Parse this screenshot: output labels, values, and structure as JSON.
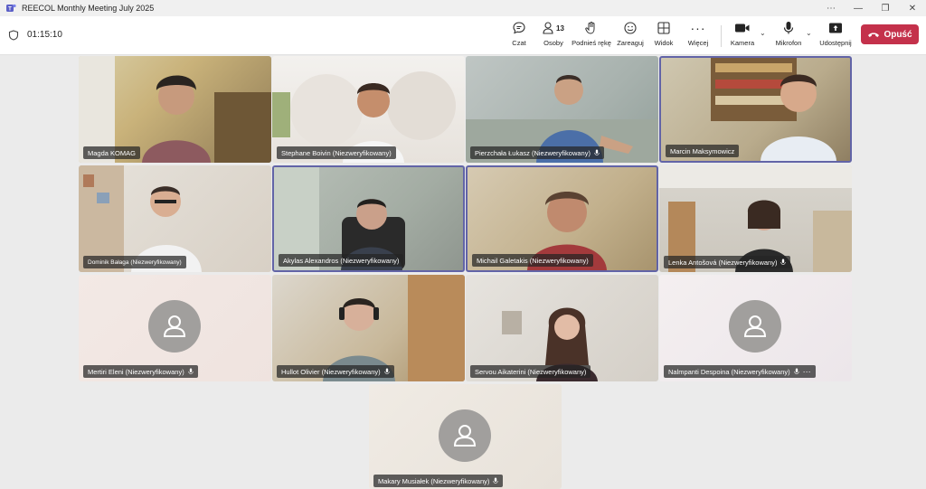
{
  "window": {
    "title": "REECOL Monthly Meeting July 2025",
    "controls": [
      "⋯",
      "—",
      "❐",
      "✕"
    ]
  },
  "toolbar": {
    "timer": "01:15:10",
    "chat": "Czat",
    "people": "Osoby",
    "people_count": "13",
    "raise": "Podnieś rękę",
    "react": "Zareaguj",
    "view": "Widok",
    "more": "Więcej",
    "camera": "Kamera",
    "mic": "Mikrofon",
    "share": "Udostępnij",
    "leave": "Opuść"
  },
  "colors": {
    "accent": "#6264a7",
    "leave": "#c4314b"
  },
  "participants": [
    {
      "name": "Magda KOMAG"
    },
    {
      "name": "Stephane Boivin (Niezweryfikowany)"
    },
    {
      "name": "Pierzchała Łukasz (Niezweryfikowany)"
    },
    {
      "name": "Marcin Maksymowicz"
    },
    {
      "name": "Dominik Bałaga (Niezweryfikowany)"
    },
    {
      "name": "Akylas Alexandros (Niezweryfikowany)"
    },
    {
      "name": "Michail Galetakis (Niezweryfikowany)"
    },
    {
      "name": "Lenka Antošová (Niezweryfikowany)"
    },
    {
      "name": "Mertiri Eleni (Niezweryfikowany)"
    },
    {
      "name": "Hullot Olivier (Niezweryfikowany)"
    },
    {
      "name": "Servou Aikaterini (Niezweryfikowany)"
    },
    {
      "name": "Nalmpanti Despoina (Niezweryfikowany)"
    },
    {
      "name": "Makary Musiałek (Niezweryfikowany)"
    }
  ]
}
